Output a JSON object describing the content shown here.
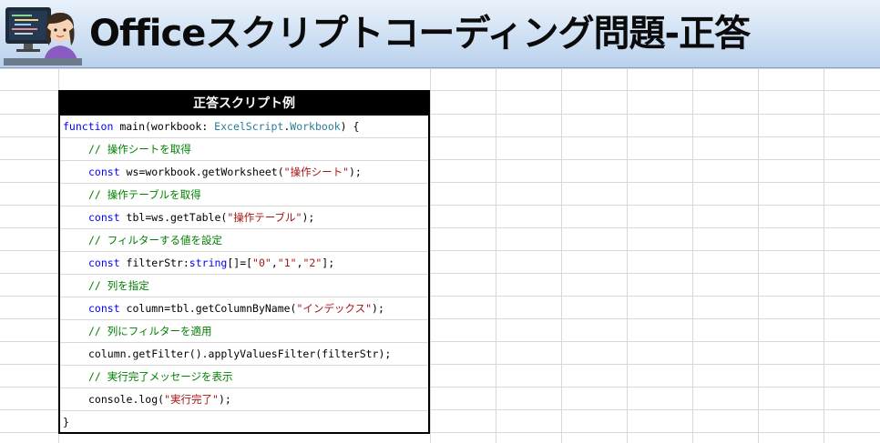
{
  "banner": {
    "title": "Officeスクリプトコーディング問題-正答"
  },
  "codebox": {
    "header": "正答スクリプト例",
    "lines": [
      {
        "kw": "function",
        "rest1": " main(workbook: ",
        "ty1": "ExcelScript",
        "dot": ".",
        "ty2": "Workbook",
        "rest2": ") {"
      },
      {
        "comment": "// 操作シートを取得"
      },
      {
        "kw": "const",
        "rest1": " ws=workbook.getWorksheet(",
        "str": "\"操作シート\"",
        "rest2": ");"
      },
      {
        "comment": "// 操作テーブルを取得"
      },
      {
        "kw": "const",
        "rest1": " tbl=ws.getTable(",
        "str": "\"操作テーブル\"",
        "rest2": ");"
      },
      {
        "comment": "// フィルターする値を設定"
      },
      {
        "kw": "const",
        "rest1": " filterStr:",
        "kw2": "string",
        "rest2": "[]=[",
        "s1": "\"0\"",
        "c1": ",",
        "s2": "\"1\"",
        "c2": ",",
        "s3": "\"2\"",
        "rest3": "];"
      },
      {
        "comment": "// 列を指定"
      },
      {
        "kw": "const",
        "rest1": " column=tbl.getColumnByName(",
        "str": "\"インデックス\"",
        "rest2": ");"
      },
      {
        "comment": "// 列にフィルターを適用"
      },
      {
        "plain": "column.getFilter().applyValuesFilter(filterStr);"
      },
      {
        "comment": "// 実行完了メッセージを表示"
      },
      {
        "rest1": "console.log(",
        "str": "\"実行完了\"",
        "rest2": ");"
      },
      {
        "plain": "}"
      }
    ]
  }
}
